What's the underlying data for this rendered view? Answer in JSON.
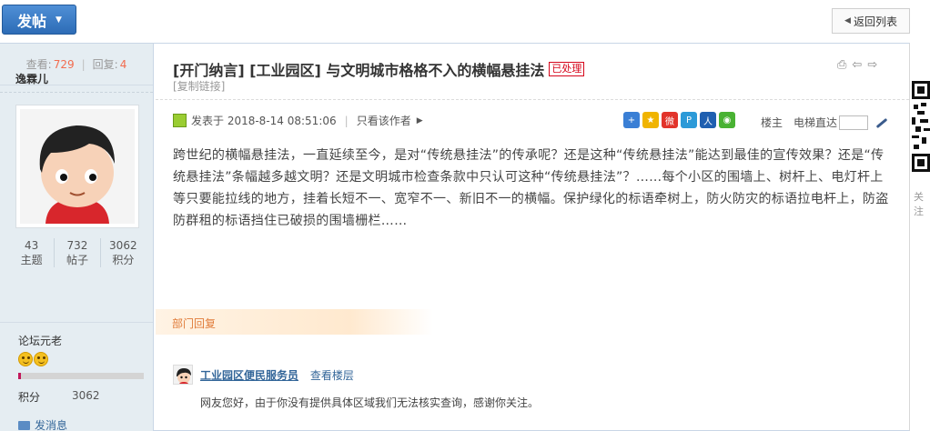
{
  "toolbar": {
    "post_label": "发帖",
    "back_label": "返回列表"
  },
  "thread_stats": {
    "views_label": "查看:",
    "views": "729",
    "replies_label": "回复:",
    "replies": "4"
  },
  "thread": {
    "title": "[开门纳言] [工业园区] 与文明城市格格不入的横幅悬挂法",
    "badge": "已处理",
    "copy_link": "[复制链接]"
  },
  "author": {
    "name": "逸霖儿",
    "stats": [
      {
        "value": "43",
        "label": "主题"
      },
      {
        "value": "732",
        "label": "帖子"
      },
      {
        "value": "3062",
        "label": "积分"
      }
    ],
    "rank": "论坛元老",
    "level_progress": 0.02,
    "score_label": "积分",
    "score_value": "3062",
    "message_label": "发消息"
  },
  "post": {
    "posted_at": "发表于 2018-8-14 08:51:06",
    "author_only": "只看该作者",
    "floor_label": "楼主",
    "jump_label": "电梯直达",
    "content": "跨世纪的横幅悬挂法，一直延续至今，是对“传统悬挂法”的传承呢？还是这种“传统悬挂法”能达到最佳的宣传效果？还是“传统悬挂法”条幅越多越文明？还是文明城市检查条款中只认可这种“传统悬挂法”？……每个小区的围墙上、树杆上、电灯杆上等只要能拉线的地方，挂着长短不一、宽窄不一、新旧不一的横幅。保护绿化的标语牵树上，防火防灾的标语拉电杆上，防盗防群租的标语挡住已破损的围墙栅栏……"
  },
  "share_icons": [
    "plus-share-icon",
    "qzone-icon",
    "weibo-icon",
    "tencent-weibo-icon",
    "renren-icon",
    "wechat-icon"
  ],
  "department": {
    "header": "部门回复",
    "replier": "工业园区便民服务员",
    "view_floor": "查看楼层",
    "reply": "网友您好，由于你没有提供具体区域我们无法核实查询，感谢你关注。"
  },
  "side_qr": {
    "label": "关注"
  },
  "colors": {
    "accent": "#2d6cb6",
    "sidebar_bg": "#e5edf2",
    "badge_red": "#d6061b",
    "dept_orange": "#e07b39"
  }
}
